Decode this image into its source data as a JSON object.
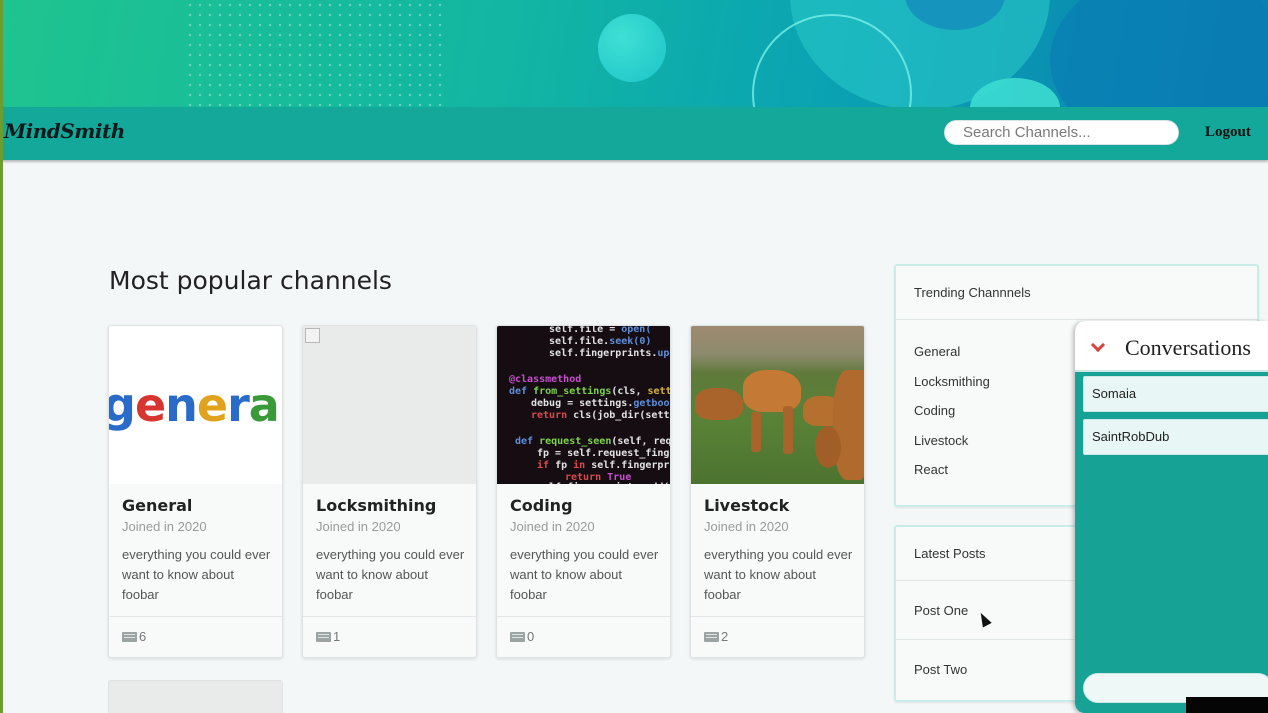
{
  "app": {
    "logo": "MindSmith"
  },
  "header": {
    "search_placeholder": "Search Channels...",
    "logout_label": "Logout"
  },
  "main": {
    "title": "Most popular channels",
    "channels": [
      {
        "name": "General",
        "joined": "Joined in 2020",
        "description": "everything you could ever want to know about foobar",
        "post_count": "6",
        "image": "general-word-art",
        "image_text": "general"
      },
      {
        "name": "Locksmithing",
        "joined": "Joined in 2020",
        "description": "everything you could ever want to know about foobar",
        "post_count": "1",
        "image": "broken-image-icon"
      },
      {
        "name": "Coding",
        "joined": "Joined in 2020",
        "description": "everything you could ever want to know about foobar",
        "post_count": "0",
        "image": "code-screenshot"
      },
      {
        "name": "Livestock",
        "joined": "Joined in 2020",
        "description": "everything you could ever want to know about foobar",
        "post_count": "2",
        "image": "cows-in-field"
      }
    ]
  },
  "sidebar": {
    "trending": {
      "title": "Trending Channnels",
      "items": [
        "General",
        "Locksmithing",
        "Coding",
        "Livestock",
        "React"
      ]
    },
    "latest": {
      "title": "Latest Posts",
      "items": [
        "Post One",
        "Post Two"
      ]
    }
  },
  "conversations": {
    "title": "Conversations",
    "items": [
      "Somaia",
      "SaintRobDub"
    ]
  },
  "colors": {
    "navbar": "#14a89a",
    "conversations_bg": "#16a396",
    "chevron": "#d7423c"
  }
}
